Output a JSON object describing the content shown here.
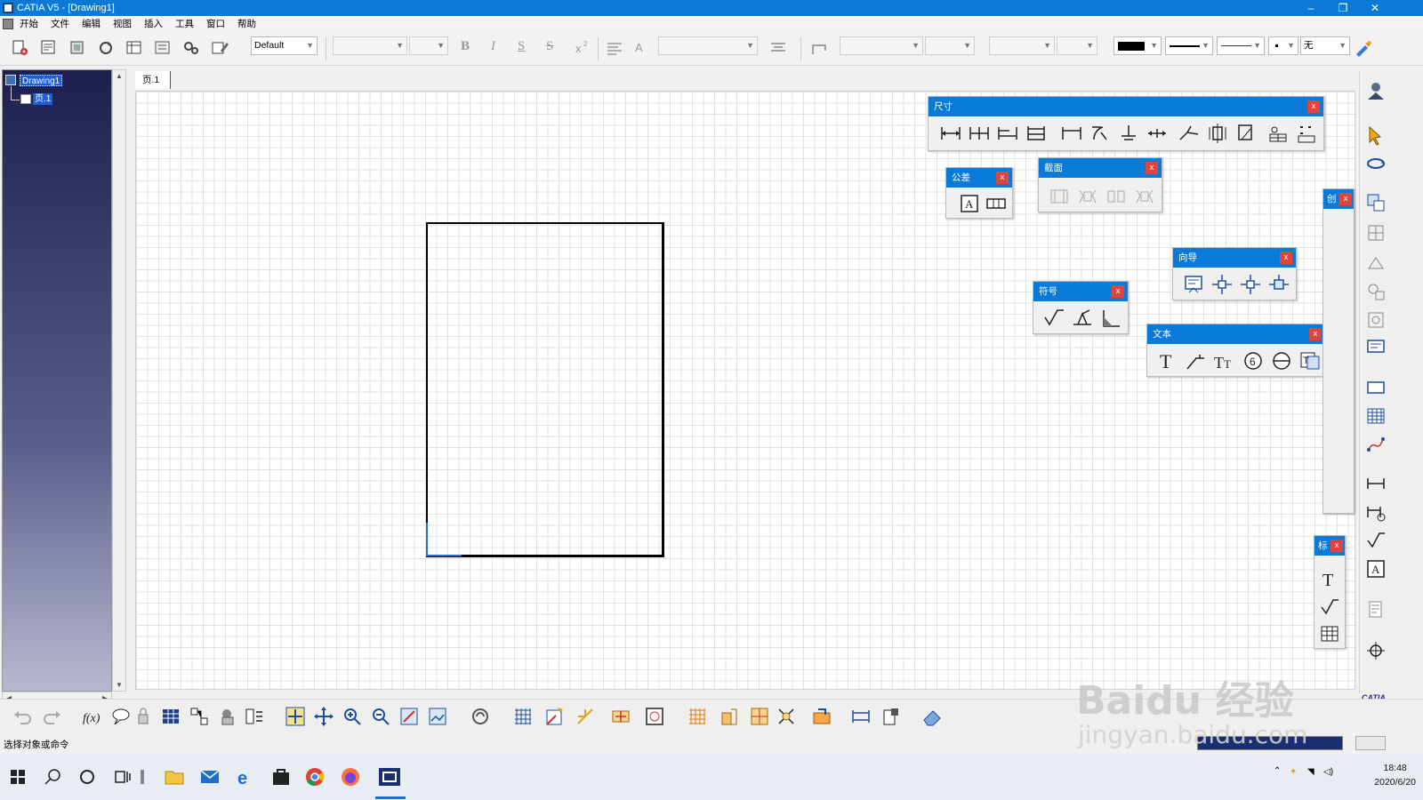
{
  "window": {
    "title": "CATIA V5 - [Drawing1]",
    "min": "–",
    "restore": "❐",
    "close": "✕",
    "mdi_min": "–",
    "mdi_restore": "❐",
    "mdi_close": "✕"
  },
  "menu": [
    "开始",
    "文件",
    "编辑",
    "视图",
    "插入",
    "工具",
    "窗口",
    "帮助"
  ],
  "toolbar": {
    "style_combo": "Default",
    "bold": "B",
    "italic": "I",
    "strike": "S",
    "color_none": "无"
  },
  "tree": {
    "root": "Drawing1",
    "sheet": "页.1"
  },
  "sheet_tab": "页.1",
  "palettes": {
    "dimensions": "尺寸",
    "tolerance": "公差",
    "section": "截面",
    "guide": "向导",
    "symbols": "符号",
    "text": "文本",
    "create": "创",
    "annot": "标",
    "close": "x"
  },
  "status": "选择对象或命令",
  "clock": {
    "time": "18:48",
    "date": "2020/6/20"
  },
  "watermark": {
    "line1": "Baidu 经验",
    "line2": "jingyan.baidu.com"
  },
  "catia_logo": "CATIA",
  "colors": {
    "title": "#0b79d6",
    "palette_head": "#0a7ad8",
    "tree_top": "#1d1f4e",
    "close": "#e0443a"
  }
}
